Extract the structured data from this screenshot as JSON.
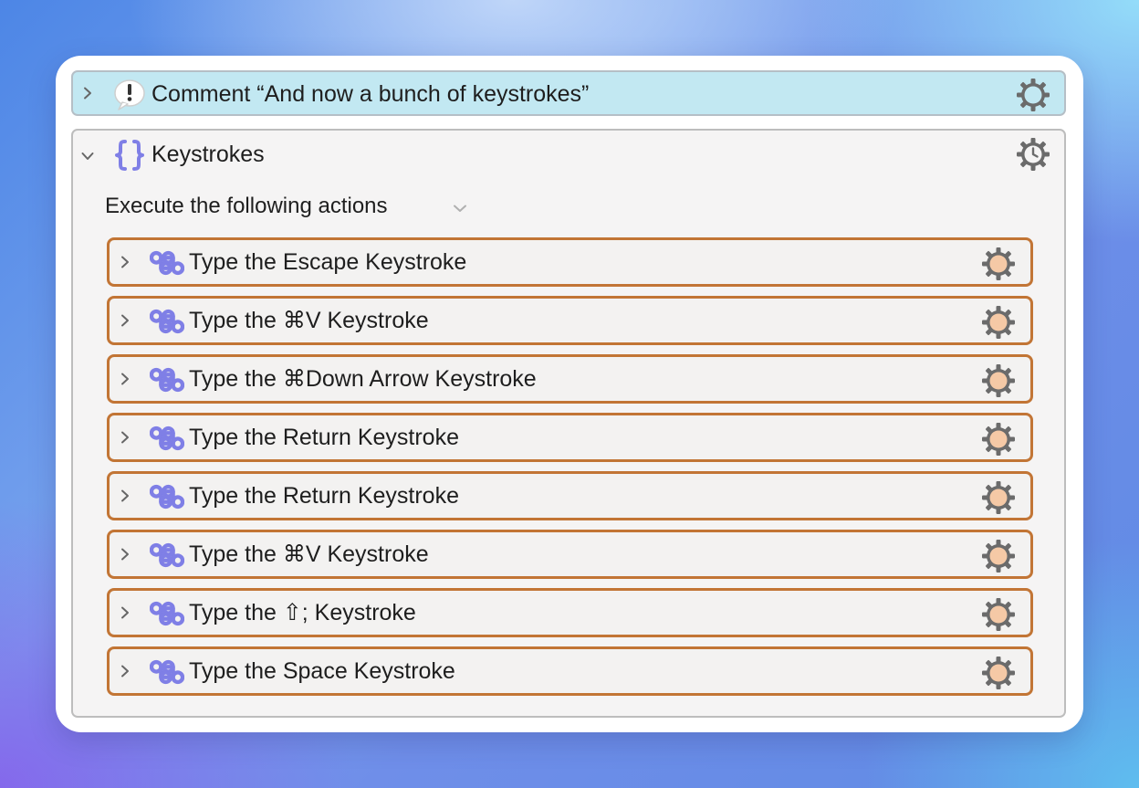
{
  "comment": {
    "title": "Comment “And now a bunch of keystrokes”"
  },
  "group": {
    "title": "Keystrokes",
    "execute_label": "Execute the following actions"
  },
  "actions": [
    {
      "title": "Type the Escape Keystroke"
    },
    {
      "title": "Type the ⌘V Keystroke"
    },
    {
      "title": "Type the ⌘Down Arrow Keystroke"
    },
    {
      "title": "Type the Return Keystroke"
    },
    {
      "title": "Type the Return Keystroke"
    },
    {
      "title": "Type the ⌘V Keystroke"
    },
    {
      "title": "Type the ⇧; Keystroke"
    },
    {
      "title": "Type the Space Keystroke"
    }
  ],
  "icons": {
    "comment": "comment-bubble-icon",
    "group": "curly-braces-icon",
    "action": "command-key-icon",
    "settings": "gear-icon",
    "group_settings": "gear-clock-icon",
    "expand": "chevron-right-icon",
    "collapse": "chevron-down-icon"
  },
  "colors": {
    "comment_bg": "#c2e8f2",
    "action_border": "#c27535",
    "command_icon": "#7f7fe6",
    "gear_fill": "#f5c9a6"
  }
}
